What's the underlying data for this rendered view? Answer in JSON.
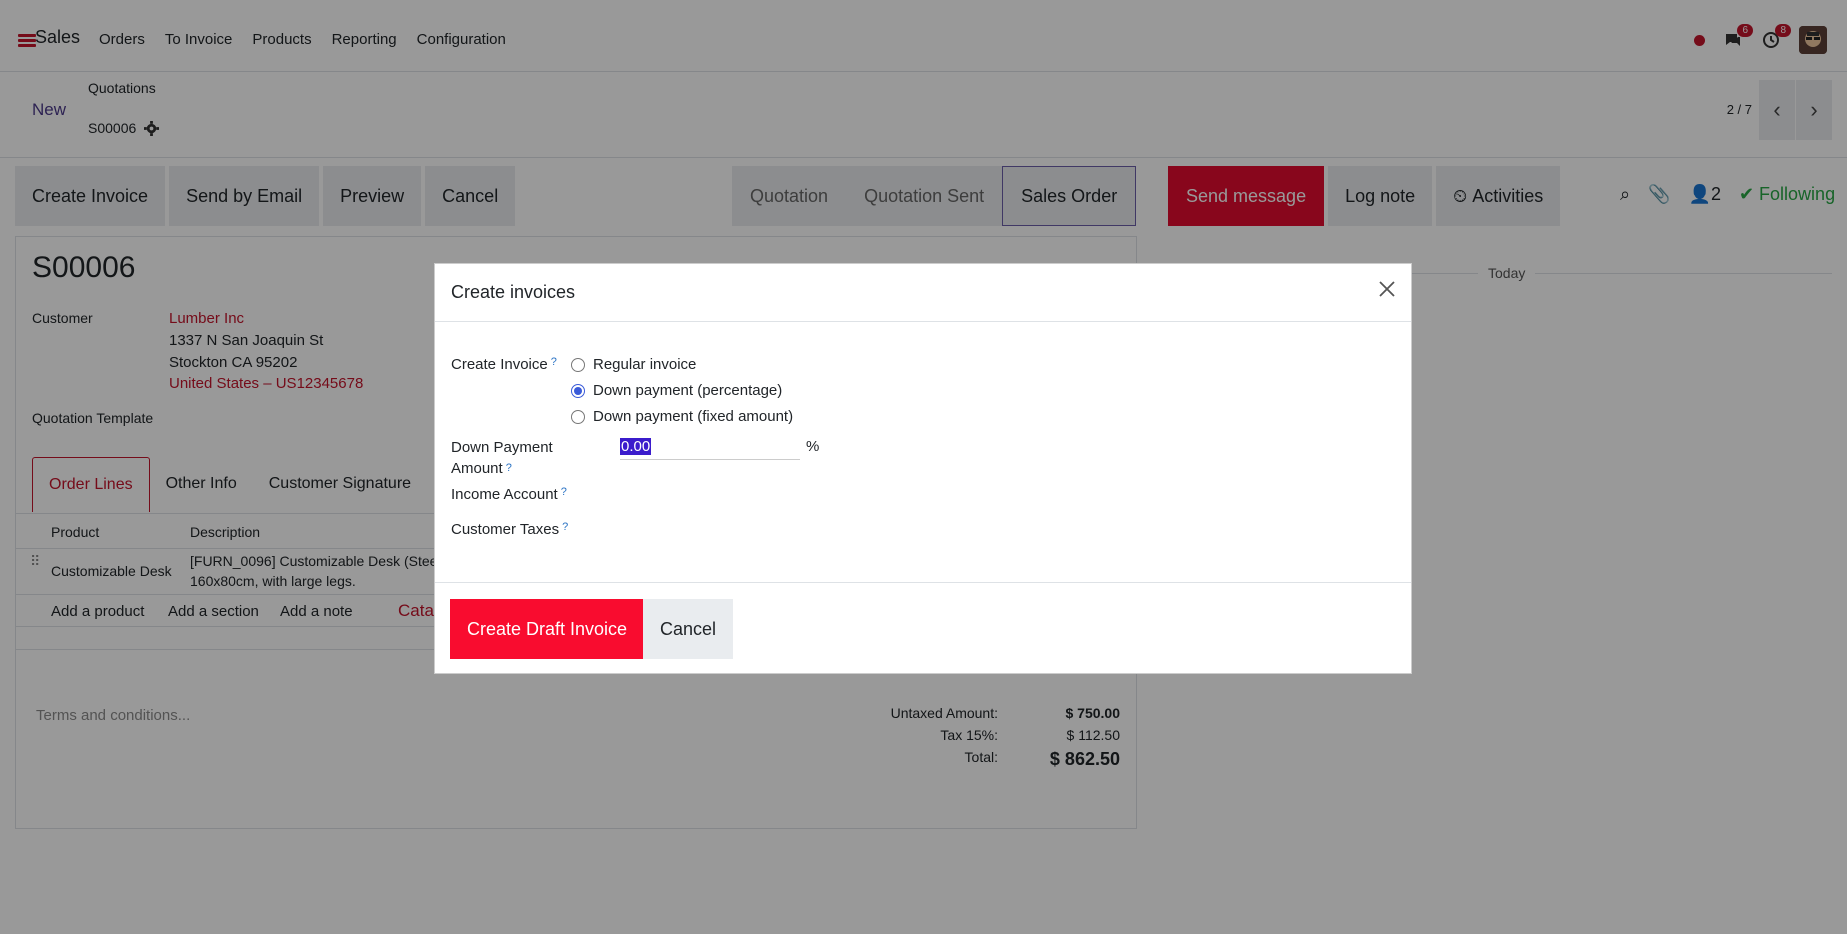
{
  "navbar": {
    "app_name": "Sales",
    "items": [
      "Orders",
      "To Invoice",
      "Products",
      "Reporting",
      "Configuration"
    ],
    "chat_badge": "6",
    "activity_badge": "8"
  },
  "control_panel": {
    "new_label": "New",
    "breadcrumb": "Quotations",
    "record_name": "S00006",
    "pager": "2 / 7"
  },
  "actions": {
    "create_invoice": "Create Invoice",
    "send_email": "Send by Email",
    "preview": "Preview",
    "cancel": "Cancel"
  },
  "statusbar": [
    "Quotation",
    "Quotation Sent",
    "Sales Order"
  ],
  "chatter": {
    "send_message": "Send message",
    "log_note": "Log note",
    "activities": "Activities",
    "followers_count": "2",
    "following": "Following",
    "today": "Today"
  },
  "form": {
    "title": "S00006",
    "customer_label": "Customer",
    "customer_name": "Lumber Inc",
    "address_line1": "1337 N San Joaquin St",
    "address_line2": "Stockton CA 95202",
    "address_line3": "United States – US12345678",
    "template_label": "Quotation Template",
    "tabs": [
      "Order Lines",
      "Other Info",
      "Customer Signature"
    ],
    "columns": [
      "Product",
      "Description"
    ],
    "line_product": "Customizable Desk",
    "line_desc1": "[FURN_0096] Customizable Desk (Stee",
    "line_desc2": "160x80cm, with large legs.",
    "add_product": "Add a product",
    "add_section": "Add a section",
    "add_note": "Add a note",
    "catalog": "Cata",
    "terms_placeholder": "Terms and conditions...",
    "untaxed_label": "Untaxed Amount:",
    "untaxed_value": "$ 750.00",
    "tax_label": "Tax 15%:",
    "tax_value": "$ 112.50",
    "total_label": "Total:",
    "total_value": "$ 862.50"
  },
  "modal": {
    "title": "Create invoices",
    "create_invoice_label": "Create Invoice",
    "options": [
      "Regular invoice",
      "Down payment (percentage)",
      "Down payment (fixed amount)"
    ],
    "selected_option": "Down payment (percentage)",
    "down_payment_label_1": "Down Payment",
    "down_payment_label_2": "Amount",
    "down_payment_value": "0.00",
    "down_payment_unit": "%",
    "income_account_label": "Income Account",
    "customer_taxes_label": "Customer Taxes",
    "help_mark": "?",
    "create_draft_button": "Create Draft Invoice",
    "cancel_button": "Cancel"
  }
}
